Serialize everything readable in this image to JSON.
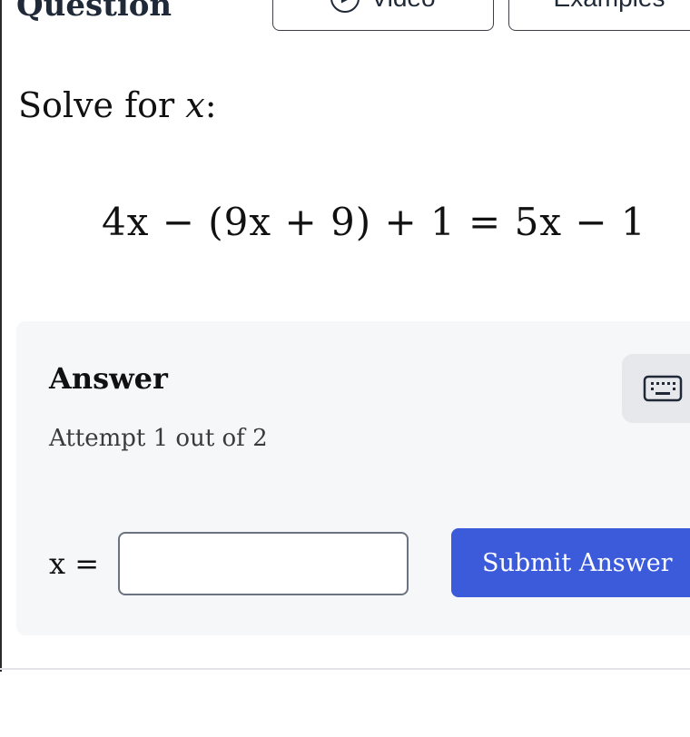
{
  "header": {
    "cut_title": "Question",
    "video_label": "Video",
    "examples_label": "Examples"
  },
  "question": {
    "prompt_text": "Solve for ",
    "variable": "x",
    "prompt_suffix": ":",
    "equation": "4x − (9x + 9) + 1 = 5x − 1"
  },
  "answer": {
    "title": "Answer",
    "attempt_text": "Attempt 1 out of 2",
    "input_label": "x =",
    "input_value": "",
    "input_placeholder": "",
    "submit_label": "Submit Answer"
  },
  "colors": {
    "submit_bg": "#3b5bdb",
    "panel_bg": "#f6f7f9",
    "keyboard_btn_bg": "#e6e8ec"
  },
  "icons": {
    "video": "play-circle-icon",
    "keyboard": "keyboard-icon"
  }
}
